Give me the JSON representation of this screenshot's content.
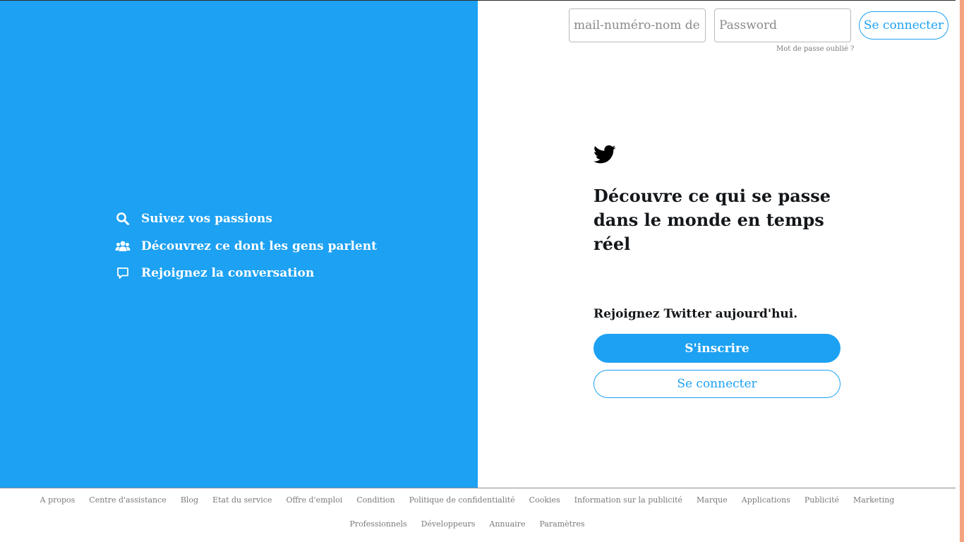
{
  "left_panel": {
    "background": "#1da1f2",
    "features": [
      {
        "icon": "search-icon",
        "label": "Suivez vos passions"
      },
      {
        "icon": "people-icon",
        "label": "Découvrez ce dont les gens parlent"
      },
      {
        "icon": "chat-bubble-icon",
        "label": "Rejoignez la conversation"
      }
    ]
  },
  "login_bar": {
    "email_placeholder": "mail-numéro-nom de c",
    "password_placeholder": "Password",
    "forgot_label": "Mot de passe oublié ?",
    "login_button": "Se connecter"
  },
  "main": {
    "logo_icon": "twitter-bird-icon",
    "headline": "Découvre ce qui se passe dans le monde en temps réel",
    "join_text": "Rejoignez Twitter aujourd'hui.",
    "signup_button": "S'inscrire",
    "login_button": "Se connecter",
    "accent_color": "#1da1f2"
  },
  "footer": {
    "row1": [
      "A propos",
      "Centre d'assistance",
      "Blog",
      "Etat du service",
      "Offre d'emploi",
      "Condition",
      "Politique de confidentialité",
      "Cookies",
      "Information sur la publicité",
      "Marque",
      "Applications",
      "Publicité",
      "Marketing"
    ],
    "row2": [
      "Professionnels",
      "Développeurs",
      "Annuaire",
      "Paramètres"
    ]
  }
}
